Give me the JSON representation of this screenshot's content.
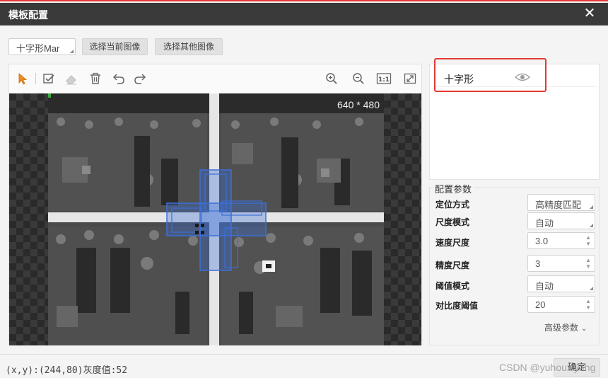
{
  "dialog": {
    "title": "模板配置",
    "close_glyph": "✕",
    "close_icon": "close-icon"
  },
  "top_controls": {
    "template_type": "十字形Mar",
    "select_current_image": "选择当前图像",
    "select_other_image": "选择其他图像"
  },
  "toolbar": {
    "icons": [
      "pointer-icon",
      "checkbox-edit-icon",
      "eraser-icon",
      "trash-icon",
      "undo-icon",
      "redo-icon",
      "zoom-in-icon",
      "zoom-out-icon",
      "actual-size-icon",
      "fit-window-icon"
    ],
    "actual_size_label": "1:1"
  },
  "viewport": {
    "image_size": "640 * 480"
  },
  "template_list": {
    "items": [
      {
        "label": "十字形",
        "icon": "eye-icon"
      }
    ]
  },
  "params": {
    "title": "配置参数",
    "rows": [
      {
        "label": "定位方式",
        "value": "高精度匹配",
        "kind": "dropdown"
      },
      {
        "label": "尺度模式",
        "value": "自动",
        "kind": "dropdown"
      },
      {
        "label": "速度尺度",
        "value": "3.0",
        "kind": "spinner"
      },
      {
        "label": "精度尺度",
        "value": "3",
        "kind": "spinner"
      },
      {
        "label": "阈值模式",
        "value": "自动",
        "kind": "dropdown"
      },
      {
        "label": "对比度阈值",
        "value": "20",
        "kind": "spinner"
      }
    ],
    "advanced": "高级参数"
  },
  "status": {
    "coords": "(x,y):(244,80)灰度值:52",
    "ok_button": "确定",
    "watermark": "CSDN @yuhouxiyang"
  },
  "colors": {
    "titlebar": "#3a3a3a",
    "highlight": "#e53935",
    "selection": "#3c6fd8",
    "pointer": "#f08c1a"
  }
}
